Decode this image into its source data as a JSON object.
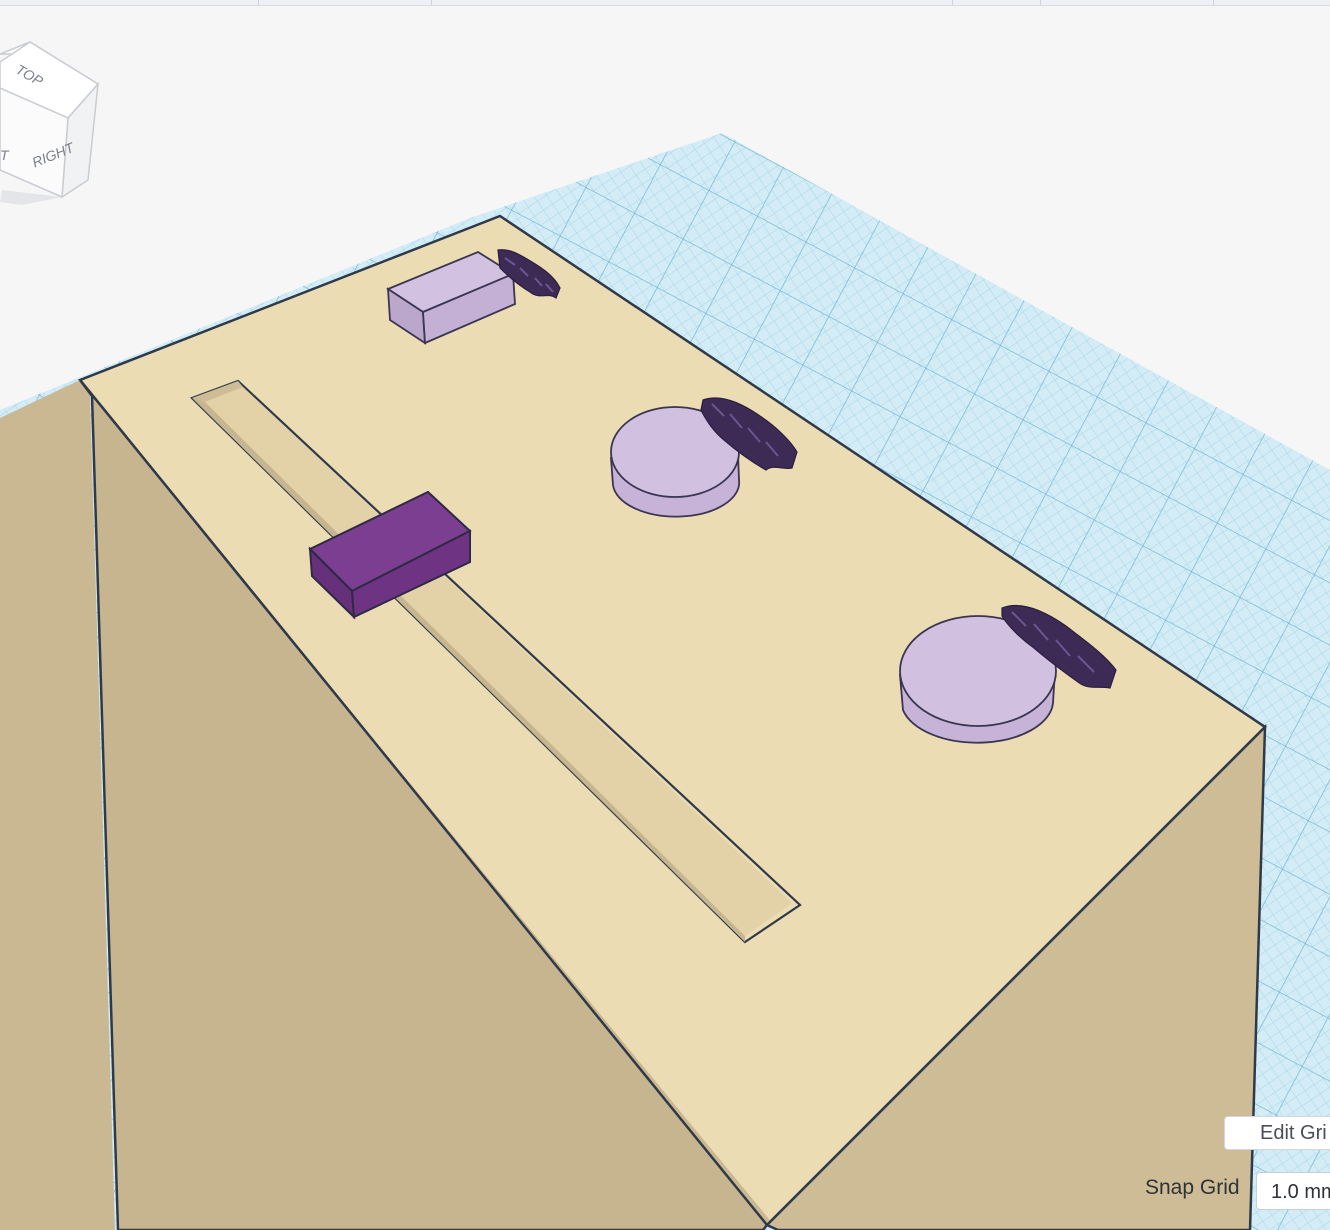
{
  "app": "Tinkercad",
  "view_cube": {
    "top_face": "TOP",
    "right_face": "RIGHT",
    "front_face_partial": "T"
  },
  "colors": {
    "workplane": "#cfe9f5",
    "grid_line": "#8fc6dd",
    "base_top": "#ecdcb3",
    "base_side": "#c9b892",
    "button_light_purple": "#cdb9dc",
    "slider_knob_purple": "#7a3d8e",
    "label_text_purple": "#3d2b55"
  },
  "controls": {
    "edit_grid_label": "Edit Gri",
    "snap_grid_label": "Snap Grid",
    "snap_grid_value": "1.0 mm"
  }
}
